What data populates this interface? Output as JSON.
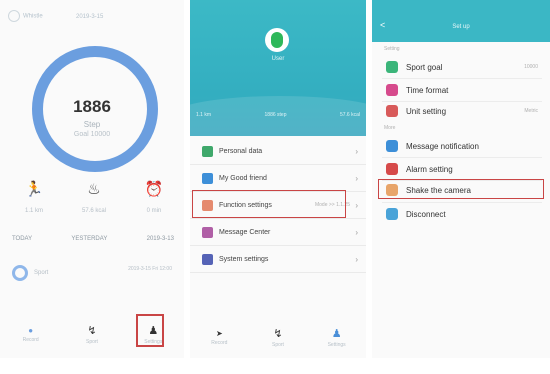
{
  "steps_screen": {
    "header_name": "Whistle",
    "header_date": "2019-3-15",
    "step_count": "1886",
    "step_label": "Step",
    "goal_text": "Goal 10000",
    "metrics": [
      {
        "icon": "running-icon",
        "glyph": "🏃",
        "value": "1.1 km"
      },
      {
        "icon": "fire-icon",
        "glyph": "♨",
        "value": "57.6 kcal"
      },
      {
        "icon": "alarm-icon",
        "glyph": "⏰",
        "value": "0 min"
      }
    ],
    "days": [
      "TODAY",
      "YESTERDAY",
      "2019-3-13"
    ],
    "sport_label": "Sport",
    "sport_right": "2019-3-15 Fri 12:00",
    "nav": [
      {
        "icon": "home-nav-icon",
        "glyph": "●",
        "label": "Record"
      },
      {
        "icon": "sport-nav-icon",
        "glyph": "↯",
        "label": "Sport"
      },
      {
        "icon": "profile-nav-icon",
        "glyph": "♟",
        "label": "Settings"
      }
    ]
  },
  "profile_screen": {
    "username": "User",
    "stats": [
      "1.1 km",
      "1886 step",
      "57.6 kcal"
    ],
    "menu": [
      {
        "label": "Personal data",
        "color": "#3fa86b",
        "icon": "personal-data-icon",
        "extra": ""
      },
      {
        "label": "My Good friend",
        "color": "#3d8fd8",
        "icon": "friend-icon",
        "extra": ""
      },
      {
        "label": "Function settings",
        "color": "#e58a6e",
        "icon": "function-settings-icon",
        "extra": "Mode >> 1.1.25"
      },
      {
        "label": "Message Center",
        "color": "#b05fa6",
        "icon": "message-center-icon",
        "extra": ""
      },
      {
        "label": "System settings",
        "color": "#5563b6",
        "icon": "system-settings-icon",
        "extra": ""
      }
    ],
    "nav": [
      {
        "icon": "home-nav-icon",
        "glyph": "➤",
        "label": "Record"
      },
      {
        "icon": "sport-nav-icon",
        "glyph": "↯",
        "label": "Sport"
      },
      {
        "icon": "profile-nav-icon",
        "glyph": "♟",
        "label": "Settings"
      }
    ]
  },
  "setup_screen": {
    "title": "Set up",
    "back_glyph": "<",
    "sections": [
      {
        "label": "Setting"
      },
      {
        "label": "More"
      }
    ],
    "items": [
      {
        "label": "Sport goal",
        "color": "#3bb57a",
        "icon": "sport-goal-icon",
        "extra": "10000"
      },
      {
        "label": "Time format",
        "color": "#d64a8c",
        "icon": "time-format-icon",
        "extra": ""
      },
      {
        "label": "Unit setting",
        "color": "#d85a5a",
        "icon": "unit-setting-icon",
        "extra": "Metric"
      },
      {
        "label": "Message notification",
        "color": "#3d8fd8",
        "icon": "message-notification-icon",
        "extra": ""
      },
      {
        "label": "Alarm setting",
        "color": "#d64a4a",
        "icon": "alarm-setting-icon",
        "extra": ""
      },
      {
        "label": "Shake the camera",
        "color": "#e8a56a",
        "icon": "camera-icon",
        "extra": ""
      },
      {
        "label": "Disconnect",
        "color": "#4aa3d8",
        "icon": "disconnect-icon",
        "extra": ""
      }
    ]
  },
  "colors": {
    "ring": "#6b9edf",
    "teal": "#3bb7c5",
    "highlight": "#c94545"
  }
}
